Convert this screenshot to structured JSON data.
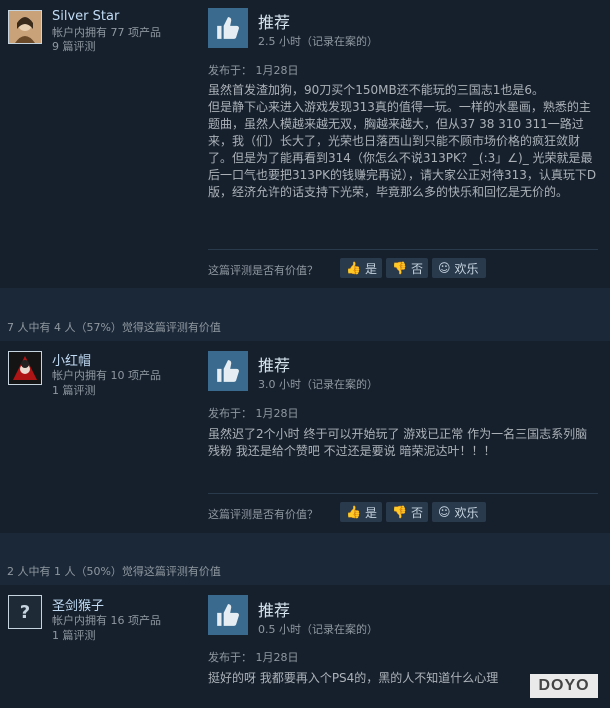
{
  "reviews": [
    {
      "username": "Silver Star",
      "products": "帐户内拥有 77 项产品",
      "review_count": "9 篇评测",
      "recommendation": "推荐",
      "hours": "2.5 小时（记录在案的）",
      "posted": "发布于：   1月28日",
      "body": "虽然首发渣加狗，90刀买个150MB还不能玩的三国志1也是6。\n但是静下心来进入游戏发现313真的值得一玩。一样的水墨画，熟悉的主题曲，虽然人模越来越无双，胸越来越大，但从37 38 310 311一路过来，我（们）长大了，光荣也日落西山到只能不顾市场价格的疯狂敛财了。但是为了能再看到314（你怎么不说313PK？_(:3」∠)_ 光荣就是最后一口气也要把313PK的钱赚完再说），请大家公正对待313，认真玩下D版，经济允许的话支持下光荣，毕竟那么多的快乐和回忆是无价的。",
      "vote_question": "这篇评测是否有价值？",
      "yes": "是",
      "no": "否",
      "funny": "欢乐"
    },
    {
      "helpful": "7 人中有 4 人（57%）觉得这篇评测有价值",
      "username": "小红帽",
      "products": "帐户内拥有 10 项产品",
      "review_count": "1 篇评测",
      "recommendation": "推荐",
      "hours": "3.0 小时（记录在案的）",
      "posted": "发布于：   1月28日",
      "body": "虽然迟了2个小时 终于可以开始玩了 游戏已正常 作为一名三国志系列脑残粉 我还是给个赞吧 不过还是要说 暗荣泥达叶！！！",
      "vote_question": "这篇评测是否有价值？",
      "yes": "是",
      "no": "否",
      "funny": "欢乐"
    },
    {
      "helpful": "2 人中有 1 人（50%）觉得这篇评测有价值",
      "username": "圣剑猴子",
      "avatar_mark": "?",
      "products": "帐户内拥有 16 项产品",
      "review_count": "1 篇评测",
      "recommendation": "推荐",
      "hours": "0.5 小时（记录在案的）",
      "posted": "发布于：   1月28日",
      "body": "挺好的呀 我都要再入个PS4的，黑的人不知道什么心理"
    }
  ],
  "watermark": "DOYO",
  "colors": {
    "background": "#1b2838",
    "card": "#16202d",
    "thumb": "#3a6b8f",
    "link": "#c1dbf4"
  }
}
